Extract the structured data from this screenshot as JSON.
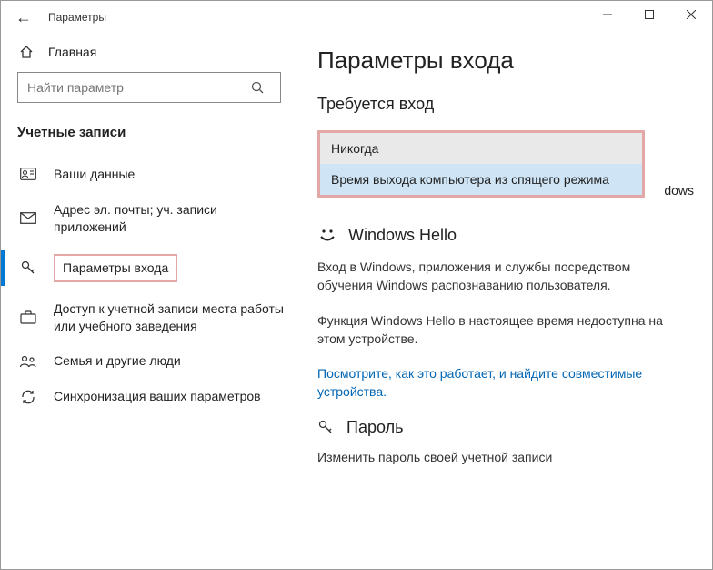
{
  "window": {
    "title": "Параметры"
  },
  "sidebar": {
    "home_label": "Главная",
    "search_placeholder": "Найти параметр",
    "section_header": "Учетные записи",
    "items": [
      {
        "label": "Ваши данные"
      },
      {
        "label": "Адрес эл. почты; уч. записи приложений"
      },
      {
        "label": "Параметры входа"
      },
      {
        "label": "Доступ к учетной записи места работы или учебного заведения"
      },
      {
        "label": "Семья и другие люди"
      },
      {
        "label": "Синхронизация ваших параметров"
      }
    ]
  },
  "content": {
    "page_title": "Параметры входа",
    "signin_heading": "Требуется вход",
    "truncated_text": "dows",
    "dropdown": {
      "opt1": "Никогда",
      "opt2": "Время выхода компьютера из спящего режима"
    },
    "hello_heading": "Windows Hello",
    "hello_desc": "Вход в Windows, приложения и службы посредством обучения Windows распознаванию пользователя.",
    "hello_unavailable": "Функция Windows Hello в настоящее время недоступна на этом устройстве.",
    "hello_link": "Посмотрите, как это работает, и найдите совместимые устройства.",
    "password_heading": "Пароль",
    "password_desc": "Изменить пароль своей учетной записи"
  }
}
